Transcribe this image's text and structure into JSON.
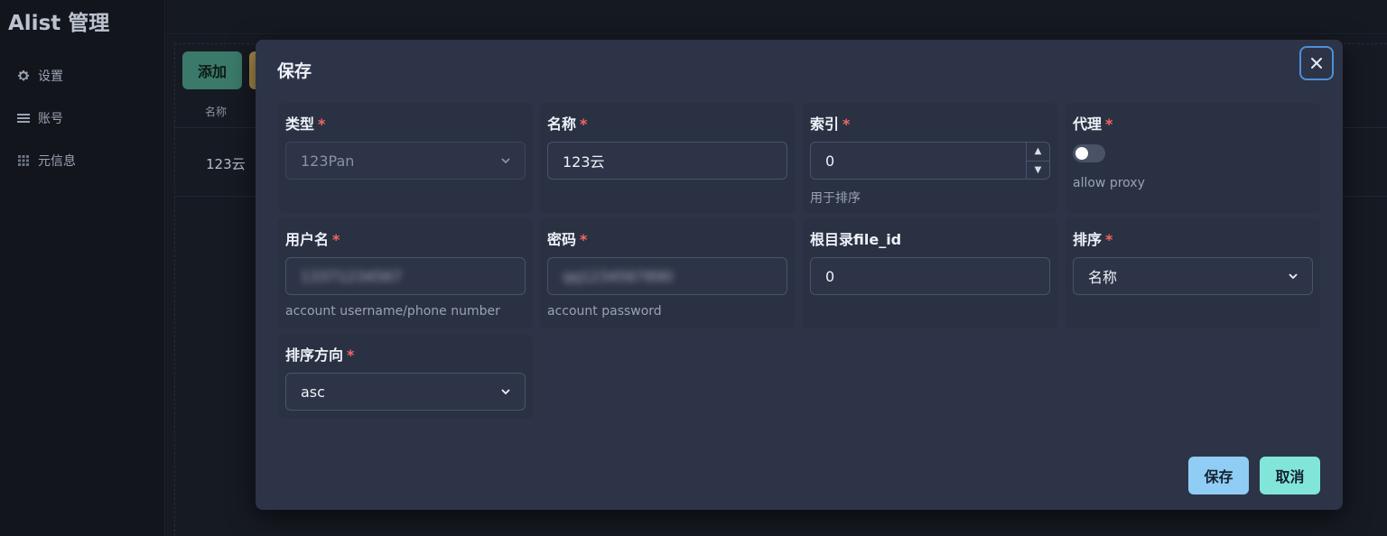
{
  "app": {
    "title": "Alist 管理"
  },
  "sidebar": {
    "items": [
      {
        "label": "设置",
        "icon": "gear-icon"
      },
      {
        "label": "账号",
        "icon": "list-icon"
      },
      {
        "label": "元信息",
        "icon": "grid-icon"
      }
    ]
  },
  "background": {
    "add_button": "添加",
    "column_name": "名称",
    "row_name": "123云"
  },
  "modal": {
    "title": "保存",
    "close_icon": "close-icon",
    "fields": {
      "type": {
        "label": "类型",
        "value": "123Pan"
      },
      "name": {
        "label": "名称",
        "value": "123云"
      },
      "index": {
        "label": "索引",
        "value": "0",
        "helper": "用于排序"
      },
      "proxy": {
        "label": "代理",
        "helper": "allow proxy",
        "enabled": false
      },
      "username": {
        "label": "用户名",
        "helper": "account username/phone number",
        "value": "13371234567"
      },
      "password": {
        "label": "密码",
        "helper": "account password",
        "value": "qq1234567890"
      },
      "root_id": {
        "label": "根目录file_id",
        "value": "0"
      },
      "order_by": {
        "label": "排序",
        "value": "名称"
      },
      "order_direction": {
        "label": "排序方向",
        "value": "asc"
      }
    },
    "required_mark": "*",
    "save_button": "保存",
    "cancel_button": "取消"
  },
  "colors": {
    "accent_save": "#90cdf4",
    "accent_cancel": "#81e6d9",
    "required": "#f56565",
    "modal_bg": "#2d3447"
  }
}
